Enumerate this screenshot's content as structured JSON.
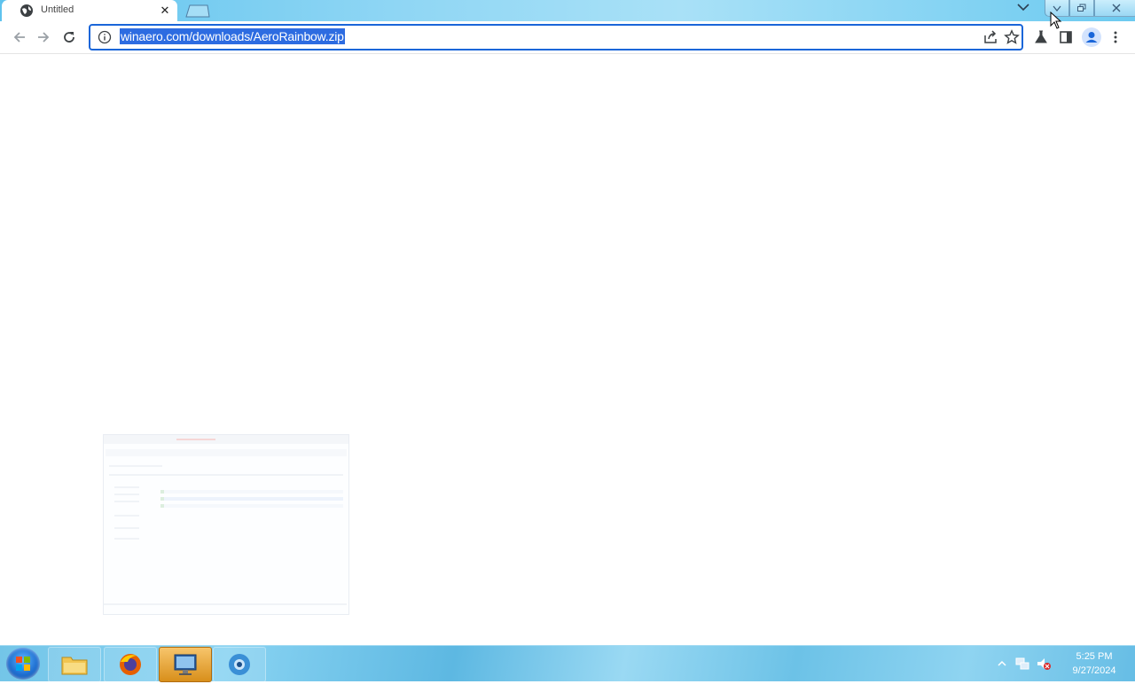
{
  "browser": {
    "tab": {
      "title": "Untitled"
    },
    "address": {
      "url": "winaero.com/downloads/AeroRainbow.zip"
    }
  },
  "taskbar": {
    "clock": {
      "time": "5:25 PM",
      "date": "9/27/2024"
    },
    "items": [
      "windows-explorer",
      "firefox",
      "remote-desktop",
      "browser"
    ]
  },
  "colors": {
    "accent": "#1a66d9",
    "selection": "#2d6ce1"
  }
}
